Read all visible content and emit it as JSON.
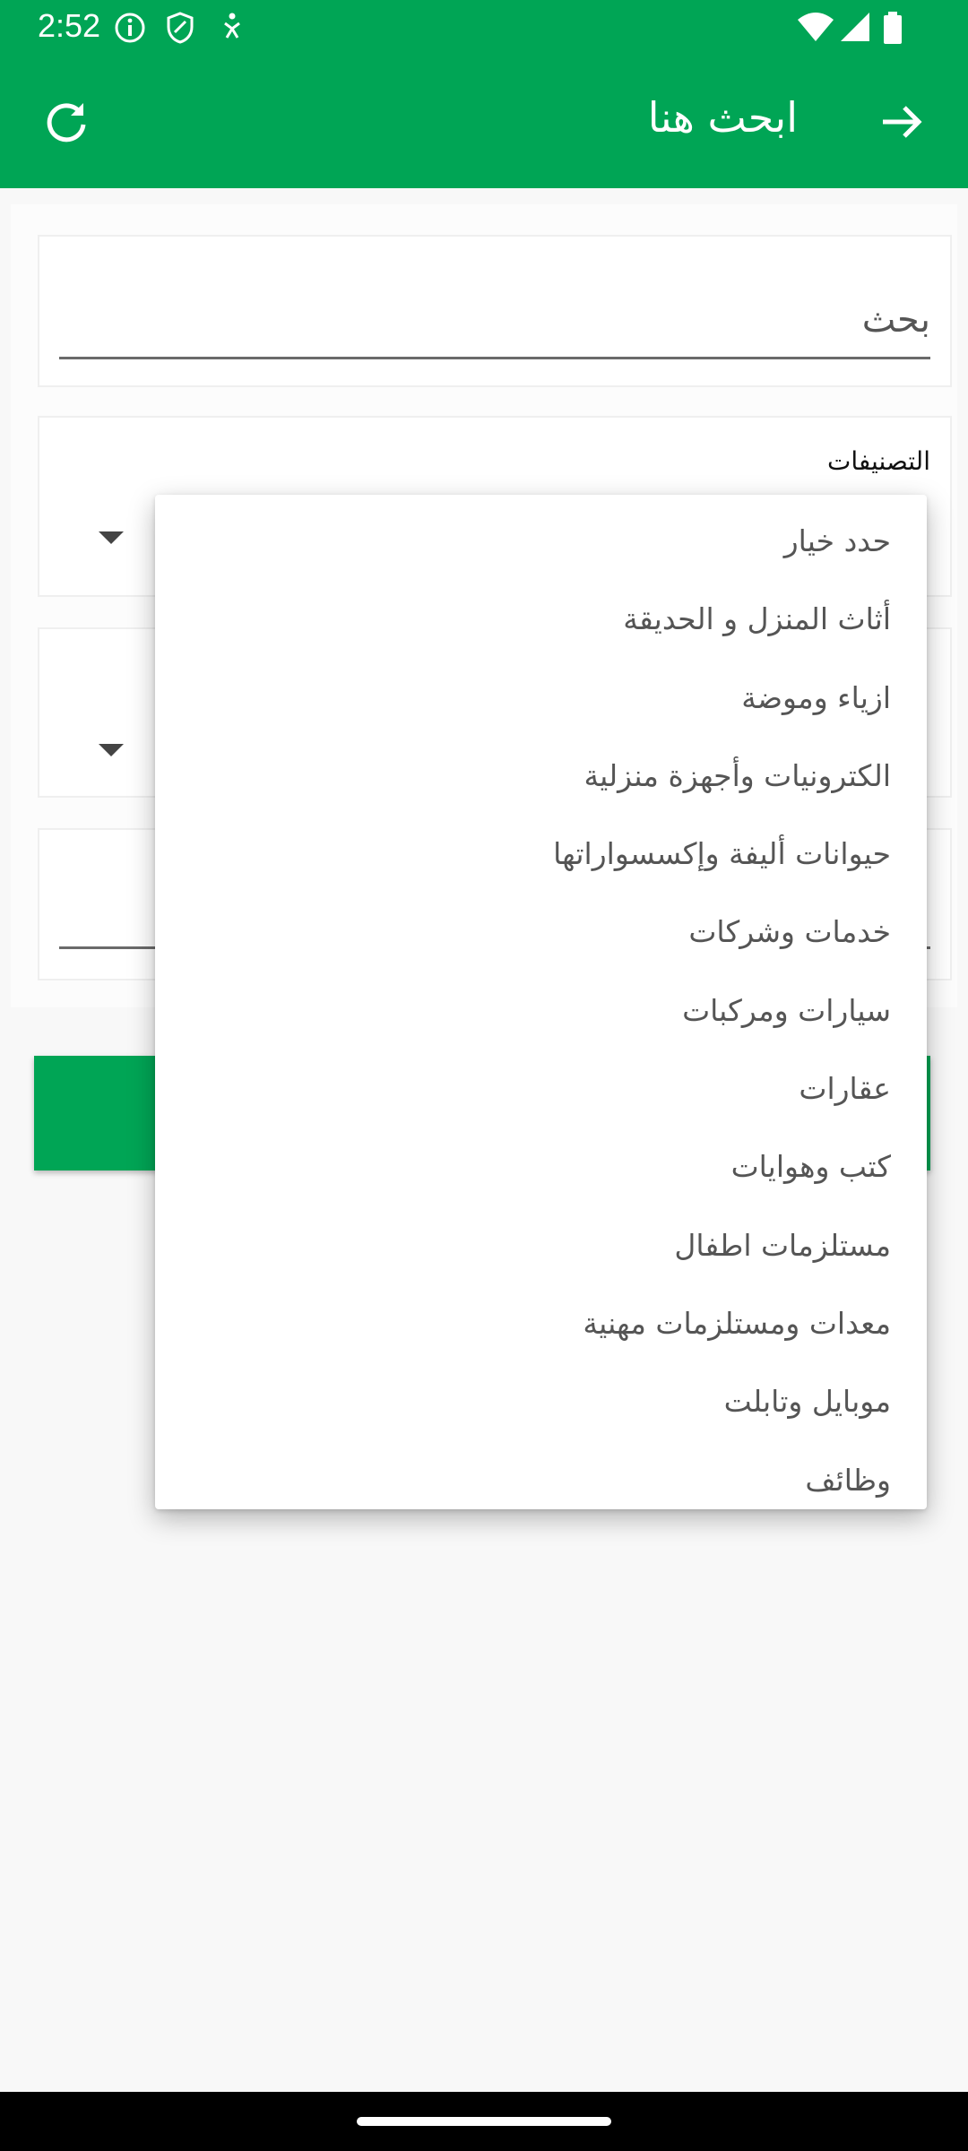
{
  "status_bar": {
    "time": "2:52"
  },
  "toolbar": {
    "title": "ابحث هنا",
    "refresh_icon": "refresh-icon",
    "back_icon": "arrow-right-icon"
  },
  "search": {
    "value": "بحث"
  },
  "categories": {
    "label": "التصنيفات"
  },
  "dropdown": {
    "items": [
      "حدد خيار",
      "أثاث المنزل و الحديقة",
      "ازياء وموضة",
      "الكترونيات وأجهزة منزلية",
      "حيوانات أليفة وإكسسواراتها",
      "خدمات وشركات",
      "سيارات ومركبات",
      "عقارات",
      "كتب وهوايات",
      "مستلزمات اطفال",
      "معدات ومستلزمات مهنية",
      "موبايل وتابلت",
      "وظائف"
    ]
  },
  "colors": {
    "primary": "#00a555",
    "background": "#f8f8f8"
  }
}
